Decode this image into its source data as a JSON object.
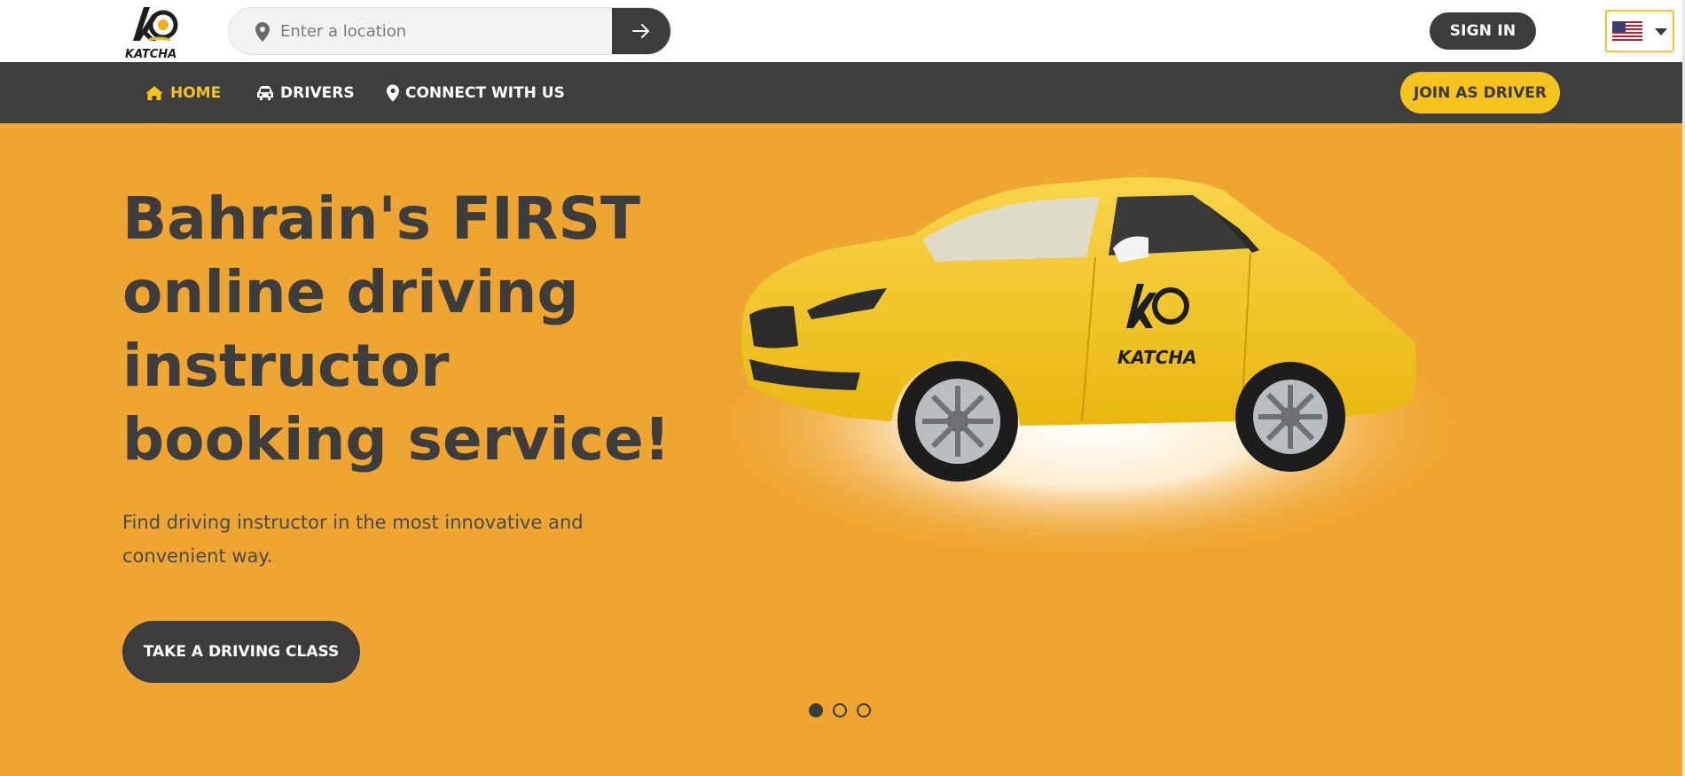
{
  "brand": {
    "name": "KATCHA",
    "logo_icon": "katcha-logo"
  },
  "search": {
    "placeholder": "Enter a location",
    "pin_icon": "map-pin-icon",
    "submit_icon": "arrow-right-icon"
  },
  "auth": {
    "signin_label": "SIGN IN"
  },
  "language": {
    "flag_icon": "us-flag-icon",
    "caret_icon": "caret-down-icon"
  },
  "nav": {
    "items": [
      {
        "label": "HOME",
        "icon": "home-icon",
        "active": true
      },
      {
        "label": "DRIVERS",
        "icon": "car-icon",
        "active": false
      },
      {
        "label": "CONNECT WITH US",
        "icon": "map-pin-icon",
        "active": false
      }
    ],
    "join_label": "JOIN AS DRIVER"
  },
  "hero": {
    "headline": "Bahrain's FIRST online driving instructor booking service!",
    "subtitle": "Find driving instructor in the most innovative and convenient way.",
    "cta_label": "TAKE A DRIVING CLASS",
    "slide_count": 3,
    "active_slide": 1
  },
  "colors": {
    "hero_bg": "#efa531",
    "dark": "#3b3c3b",
    "accent_yellow": "#f6c21e",
    "white": "#ffffff"
  }
}
